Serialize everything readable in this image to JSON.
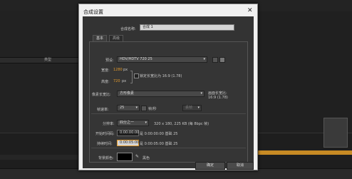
{
  "dialog": {
    "title": "合成设置",
    "close_glyph": "✕",
    "name_label": "合成名称:",
    "name_value": "合成 1",
    "tabs": [
      "基本",
      "高级"
    ],
    "preset_label": "预设:",
    "preset_value": "HDV/HDTV 720 25",
    "width_label": "宽度:",
    "width_value": "1280",
    "width_unit": "px",
    "height_label": "高度:",
    "height_value": "720",
    "height_unit": "px",
    "lock_label": "锁定长宽比为 16:9 (1.78)",
    "pixel_aspect_label": "像素长宽比:",
    "pixel_aspect_value": "方形像素",
    "frame_aspect_label": "画面长宽比:",
    "frame_aspect_value": "16:9 (1.78)",
    "frame_rate_label": "帧速率:",
    "frame_rate_value": "25",
    "frame_rate_unit": "帧/秒",
    "frame_rate_mode": "丢帧",
    "resolution_label": "分辨率:",
    "resolution_value": "四分之一",
    "resolution_info": "320 x 180, 225 KB (每 8bpc 帧)",
    "start_tc_label": "开始时间码:",
    "start_tc_value": "0:00:00:00",
    "start_tc_info": "是 0:00:00:00 基础 25",
    "duration_label": "持续时间:",
    "duration_value": "0:00:05:00",
    "duration_info": "是 0:00:05:00 基础 25",
    "bg_color_label": "背景颜色:",
    "bg_color_name": "黑色",
    "bg_color": "#000000",
    "ok_label": "确定",
    "cancel_label": "取消"
  },
  "background": {
    "left_header_label": "类型",
    "right_rows": [
      "",
      "",
      "",
      "",
      "",
      "",
      "",
      "",
      ""
    ]
  }
}
